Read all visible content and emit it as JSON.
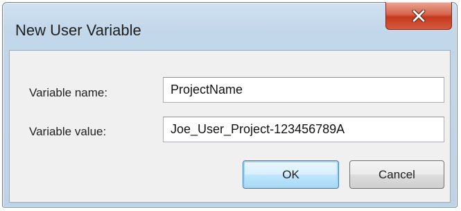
{
  "window": {
    "title": "New User Variable"
  },
  "titlebar": {
    "close_icon": "close-icon"
  },
  "form": {
    "name_label": "Variable name:",
    "name_value": "ProjectName",
    "value_label": "Variable value:",
    "value_value": "Joe_User_Project-123456789A"
  },
  "buttons": {
    "ok_label": "OK",
    "cancel_label": "Cancel"
  },
  "colors": {
    "title_accent": "#c3d7ea",
    "close_red": "#c4391e",
    "default_button_border": "#3c7fb1"
  }
}
